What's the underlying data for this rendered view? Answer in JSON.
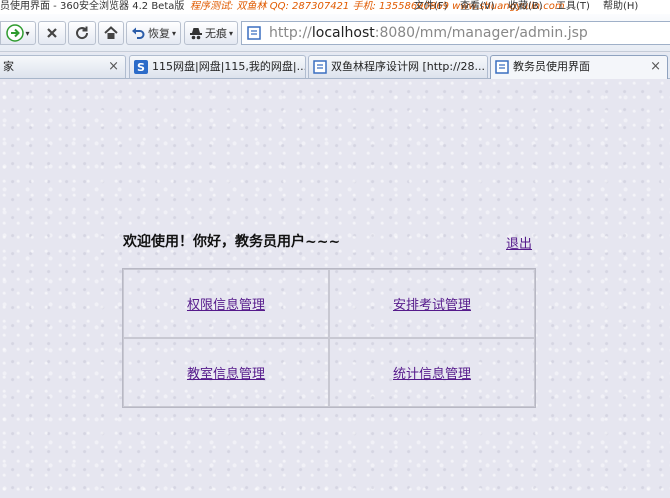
{
  "window": {
    "title": "员使用界面 - 360安全浏览器 4.2 Beta版",
    "promo": "程序测试: 双鱼林   QQ: 287307421    手机: 13558690869   www.shuangyulin.com",
    "menu": [
      "文件(F)",
      "查看(V)",
      "收藏(B)",
      "工具(T)",
      "帮助(H)"
    ]
  },
  "toolbar": {
    "restore_label": "恢复",
    "incognito_label": "无痕",
    "address_prefix": "http://",
    "address_host": "localhost",
    "address_rest": ":8080/mm/manager/admin.jsp"
  },
  "tabs": [
    {
      "label": "家"
    },
    {
      "label": "115网盘|网盘|115,我的网盘|..."
    },
    {
      "label": "双鱼林程序设计网 [http://28..."
    },
    {
      "label": "教务员使用界面"
    }
  ],
  "tab_close_glyph": "×",
  "main": {
    "welcome": "欢迎使用！你好，教务员用户~~~",
    "logout": "退出",
    "links": [
      "权限信息管理",
      "安排考试管理",
      "教室信息管理",
      "统计信息管理"
    ]
  }
}
